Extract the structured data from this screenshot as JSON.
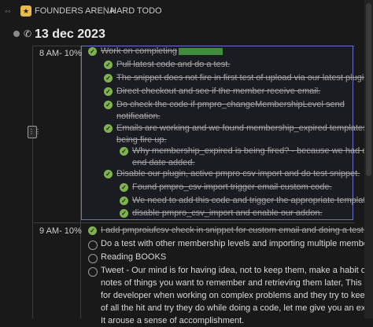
{
  "breadcrumb": {
    "workspace": "FOUNDERS ARENA",
    "page": "HARD TODO",
    "separator": "|"
  },
  "date_title": "13 dec 2023",
  "blocks": [
    {
      "time": "8 AM- 10%",
      "items": [
        {
          "text": "Work on completing",
          "done": true,
          "redacted": true
        },
        {
          "text": "Pull latest code and do a test.",
          "done": true
        },
        {
          "text": "The snippet does not fire in first test of upload via our latest plugin.",
          "done": true
        },
        {
          "text": "Direct checkout and see if the member receive email.",
          "done": true
        },
        {
          "text": "Do check the code if pmpro_changeMembershipLevel send",
          "done": true
        },
        {
          "text": "notification.",
          "done": true,
          "cont": true
        },
        {
          "text": "Emails are working and we found membership_expired templates is",
          "done": true
        },
        {
          "text": "being fire up.",
          "done": true,
          "cont": true
        },
        {
          "text": "Why membership_expired is being fired? - because we had old",
          "done": true
        },
        {
          "text": "end date added.",
          "done": true,
          "cont": true
        },
        {
          "text": "Disable our plugin, active pmpro csv import and do test snippet.",
          "done": true
        },
        {
          "text": "Found pmpro_csv import trigger email custom code.",
          "done": true
        },
        {
          "text": "We need to add this code and trigger the appropriate template.",
          "done": true
        },
        {
          "text": "disable pmpro_csv_import and enable our addon.",
          "done": true
        }
      ]
    },
    {
      "time": "9 AM- 10%",
      "items": [
        {
          "text": "I add pmproiufcsv check in snippet for custom email and doing a test again.",
          "done": true
        },
        {
          "text": "Do a test with other membership levels and importing multiple members.",
          "done": false
        },
        {
          "text": "Reading BOOKS",
          "done": false
        },
        {
          "text": "Tweet - Our mind is for having idea, not to keep them, make a habit of keep",
          "done": false
        },
        {
          "text": "notes of things you want to remember and retrieving them later, This helpful",
          "done": false,
          "cont": true
        },
        {
          "text": "for developer when working on complex problems and they try to keep log",
          "done": false,
          "cont": true
        },
        {
          "text": "of all the hit and try they do while doing a code, let me give you an example.",
          "done": false,
          "cont": true
        },
        {
          "text": "It arouse a sense of accomplishment.",
          "done": false,
          "cont": true
        }
      ]
    }
  ],
  "colors": {
    "check": "#7fb24f",
    "selection_border": "#6b73c9"
  }
}
